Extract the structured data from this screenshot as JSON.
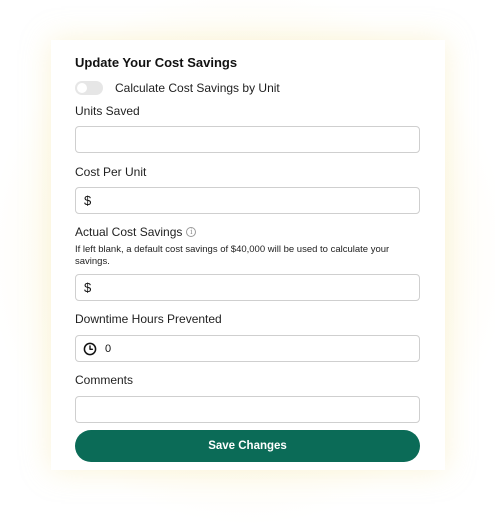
{
  "form": {
    "title": "Update Your Cost Savings",
    "toggle": {
      "label": "Calculate Cost Savings by Unit",
      "on": false
    },
    "units_saved": {
      "label": "Units Saved",
      "value": ""
    },
    "cost_per_unit": {
      "label": "Cost Per Unit",
      "prefix": "$",
      "value": ""
    },
    "actual_cost_savings": {
      "label": "Actual Cost Savings",
      "info_icon": "info-icon",
      "helper": "If left blank, a default cost savings of $40,000 will be used to calculate your savings.",
      "prefix": "$",
      "value": ""
    },
    "downtime_hours": {
      "label": "Downtime Hours Prevented",
      "icon": "clock-icon",
      "value": "0"
    },
    "comments": {
      "label": "Comments",
      "value": ""
    },
    "save_label": "Save Changes",
    "colors": {
      "primary_button": "#0b6b57",
      "toggle_off": "#e6e6e6"
    }
  }
}
